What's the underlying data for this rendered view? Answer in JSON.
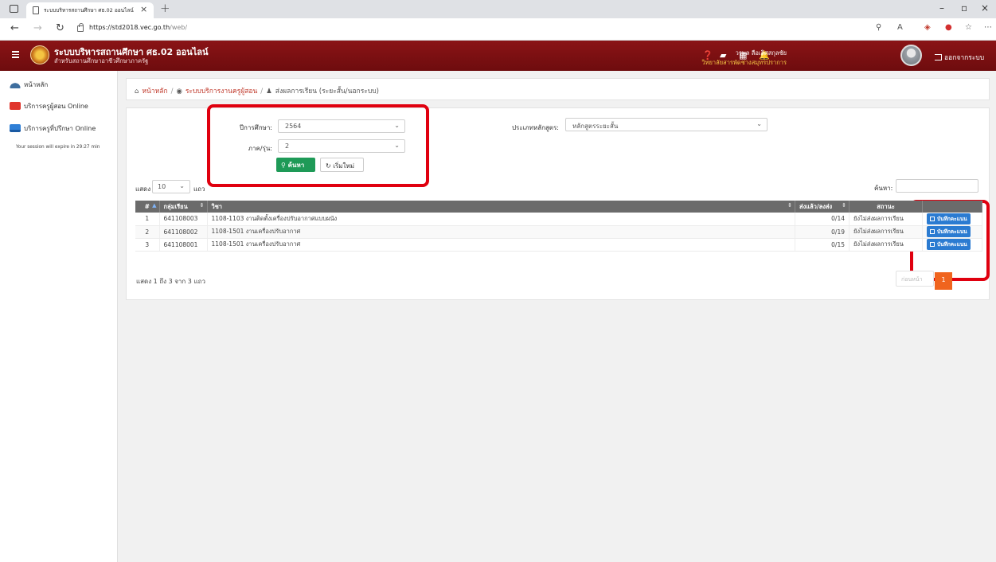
{
  "browser": {
    "tab_title": "ระบบบริหารสถานศึกษา ศธ.02 ออนไลน์",
    "tab_close": "×",
    "new_tab": "+",
    "url_host": "https://std2018.vec.go.th",
    "url_path": "/web/",
    "window_controls": [
      "–",
      "▫",
      "×"
    ]
  },
  "header": {
    "title": "ระบบบริหารสถานศึกษา ศธ.02 ออนไลน์",
    "subtitle": "สำหรับสถานศึกษาอาชีวศึกษาภาครัฐ",
    "user_name": "วรพล ลือเลิศสกุลชัย",
    "user_org": "วิทยาลัยสารพัดช่างสมุทรปราการ",
    "logout_label": "ออกจากระบบ",
    "brand_color": "#7a1012"
  },
  "sidebar": {
    "items": [
      {
        "label": "หน้าหลัก",
        "icon": "dashboard-icon"
      },
      {
        "label": "บริการครูผู้สอน Online",
        "icon": "teacher-icon"
      },
      {
        "label": "บริการครูที่ปรึกษา Online",
        "icon": "monitor-icon"
      }
    ],
    "session_note": "Your session will expire in 29:27 min"
  },
  "breadcrumb": {
    "home": "หน้าหลัก",
    "section": "ระบบบริการงานครูผู้สอน",
    "current": "ส่งผลการเรียน (ระยะสั้น/นอกระบบ)",
    "separator": "/"
  },
  "filters": {
    "year_label": "ปีการศึกษา:",
    "year_value": "2564",
    "term_label": "ภาค/รุ่น:",
    "term_value": "2",
    "course_type_label": "ประเภทหลักสูตร:",
    "course_type_value": "หลักสูตรระยะสั้น",
    "search_button": "ค้นหา",
    "reset_button": "เริ่มใหม่"
  },
  "table_controls": {
    "show_label": "แสดง",
    "page_size": "10",
    "rows_label": "แถว",
    "search_label": "ค้นหา:"
  },
  "table": {
    "headers": [
      "#",
      "กลุ่มเรียน",
      "วิชา",
      "ส่งแล้ว/ลงส่ง",
      "สถานะ",
      ""
    ],
    "rows": [
      {
        "idx": "1",
        "group": "641108003",
        "subject": "1108-1103  งานติดตั้งเครื่องปรับอากาศแบบผนัง",
        "sent": "0/14",
        "status": "ยังไม่ส่งผลการเรียน",
        "action": "บันทึกคะแนน"
      },
      {
        "idx": "2",
        "group": "641108002",
        "subject": "1108-1501  งานเครื่องปรับอากาศ",
        "sent": "0/19",
        "status": "ยังไม่ส่งผลการเรียน",
        "action": "บันทึกคะแนน"
      },
      {
        "idx": "3",
        "group": "641108001",
        "subject": "1108-1501  งานเครื่องปรับอากาศ",
        "sent": "0/15",
        "status": "ยังไม่ส่งผลการเรียน",
        "action": "บันทึกคะแนน"
      }
    ],
    "info": "แสดง 1 ถึง 3 จาก 3 แถว",
    "pagination_prev": "ก่อนหน้า",
    "pagination_page": "1"
  }
}
